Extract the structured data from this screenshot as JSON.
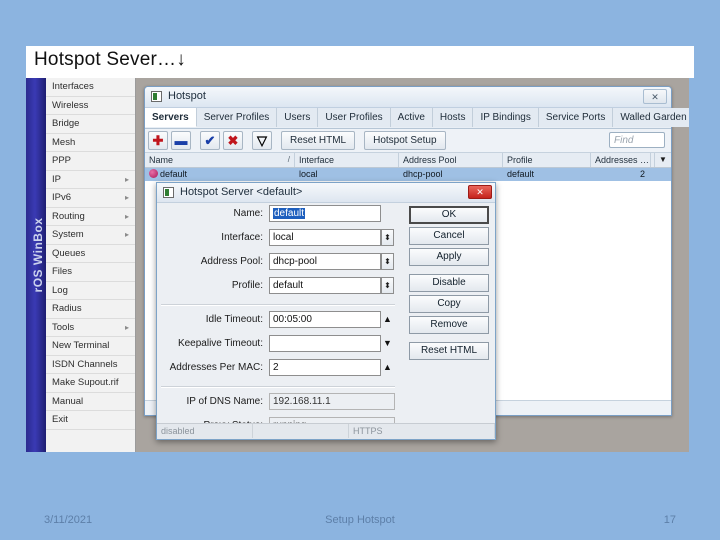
{
  "slide": {
    "title": "Hotspot Sever…↓",
    "background_color": "#8cb4e0"
  },
  "winbox": {
    "vertical_label": "rOS WinBox",
    "menu": [
      {
        "label": "Interfaces",
        "arrow": ""
      },
      {
        "label": "Wireless",
        "arrow": ""
      },
      {
        "label": "Bridge",
        "arrow": ""
      },
      {
        "label": "Mesh",
        "arrow": ""
      },
      {
        "label": "PPP",
        "arrow": ""
      },
      {
        "label": "IP",
        "arrow": "▸"
      },
      {
        "label": "IPv6",
        "arrow": "▸"
      },
      {
        "label": "Routing",
        "arrow": "▸"
      },
      {
        "label": "System",
        "arrow": "▸"
      },
      {
        "label": "Queues",
        "arrow": ""
      },
      {
        "label": "Files",
        "arrow": ""
      },
      {
        "label": "Log",
        "arrow": ""
      },
      {
        "label": "Radius",
        "arrow": ""
      },
      {
        "label": "Tools",
        "arrow": "▸"
      },
      {
        "label": "New Terminal",
        "arrow": ""
      },
      {
        "label": "ISDN Channels",
        "arrow": ""
      },
      {
        "label": "Make Supout.rif",
        "arrow": ""
      },
      {
        "label": "Manual",
        "arrow": ""
      },
      {
        "label": "Exit",
        "arrow": ""
      }
    ]
  },
  "hotspot_window": {
    "title": "Hotspot",
    "close_glyph": "✕",
    "tabs": [
      {
        "label": "Servers",
        "active": true
      },
      {
        "label": "Server Profiles",
        "active": false
      },
      {
        "label": "Users",
        "active": false
      },
      {
        "label": "User Profiles",
        "active": false
      },
      {
        "label": "Active",
        "active": false
      },
      {
        "label": "Hosts",
        "active": false
      },
      {
        "label": "IP Bindings",
        "active": false
      },
      {
        "label": "Service Ports",
        "active": false
      },
      {
        "label": "Walled Garden",
        "active": false
      },
      {
        "label": "…",
        "active": false
      }
    ],
    "toolbar": {
      "add_glyph": "✚",
      "remove_glyph": "▬",
      "enable_glyph": "✔",
      "disable_glyph": "✖",
      "filter_glyph": "▽",
      "reset_html_label": "Reset HTML",
      "hotspot_setup_label": "Hotspot Setup",
      "find_placeholder": "Find"
    },
    "table": {
      "columns": [
        "Name",
        "Interface",
        "Address Pool",
        "Profile",
        "Addresses …"
      ],
      "sort_marker": "/",
      "dropdown_glyph": "▼",
      "rows": [
        {
          "name": "default",
          "interface": "local",
          "address_pool": "dhcp-pool",
          "profile": "default",
          "addresses": "2"
        }
      ]
    }
  },
  "dialog": {
    "title": "Hotspot Server <default>",
    "close_glyph": "✕",
    "fields": [
      {
        "label": "Name:",
        "value": "default",
        "selected": true,
        "control": "text"
      },
      {
        "label": "Interface:",
        "value": "local",
        "control": "dropdown"
      },
      {
        "label": "Address Pool:",
        "value": "dhcp-pool",
        "control": "dropdown"
      },
      {
        "label": "Profile:",
        "value": "default",
        "control": "dropdown"
      },
      {
        "label": "Idle Timeout:",
        "value": "00:05:00",
        "control": "spinner-up"
      },
      {
        "label": "Keepalive Timeout:",
        "value": "",
        "control": "spinner-down"
      },
      {
        "label": "Addresses Per MAC:",
        "value": "2",
        "control": "spinner-up"
      },
      {
        "label": "IP of DNS Name:",
        "value": "192.168.11.1",
        "control": "readonly"
      },
      {
        "label": "Proxy Status:",
        "value": "running",
        "control": "readonly"
      }
    ],
    "buttons": [
      {
        "label": "OK",
        "default": true
      },
      {
        "label": "Cancel",
        "default": false
      },
      {
        "label": "Apply",
        "default": false
      },
      {
        "label": "Disable",
        "default": false
      },
      {
        "label": "Copy",
        "default": false
      },
      {
        "label": "Remove",
        "default": false
      },
      {
        "label": "Reset HTML",
        "default": false
      }
    ],
    "statusbar": [
      "disabled",
      "",
      "HTTPS"
    ]
  },
  "footer": {
    "date": "3/11/2021",
    "center": "Setup Hotspot",
    "page": "17"
  }
}
